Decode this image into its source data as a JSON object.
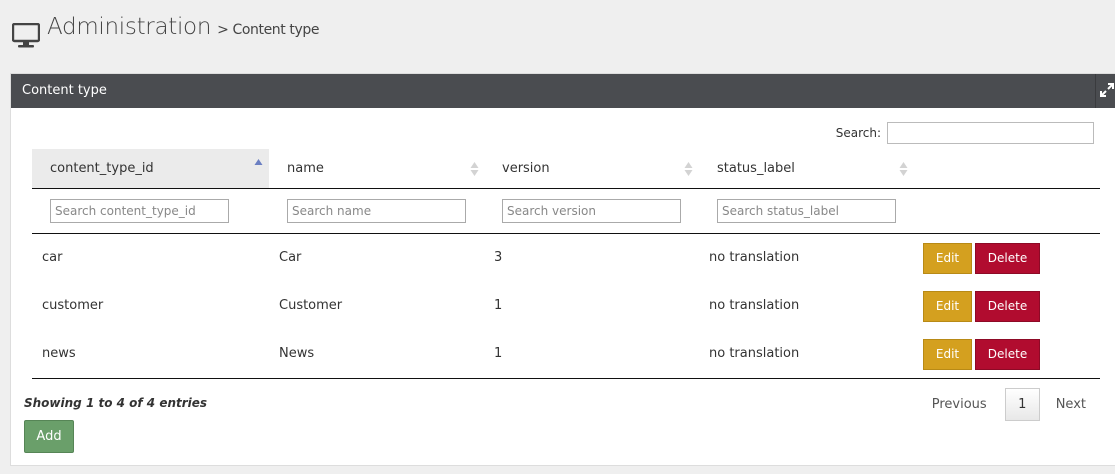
{
  "header": {
    "title": "Administration",
    "breadcrumb": "> Content type",
    "icon": "monitor-icon"
  },
  "panel": {
    "title": "Content type",
    "expand_icon": "expand-icon"
  },
  "search": {
    "label": "Search:",
    "value": ""
  },
  "table": {
    "columns": [
      {
        "label": "content_type_id",
        "filter_placeholder": "Search content_type_id"
      },
      {
        "label": "name",
        "filter_placeholder": "Search name"
      },
      {
        "label": "version",
        "filter_placeholder": "Search version"
      },
      {
        "label": "status_label",
        "filter_placeholder": "Search status_label"
      }
    ],
    "rows": [
      {
        "content_type_id": "car",
        "name": "Car",
        "version": "3",
        "status_label": "no translation"
      },
      {
        "content_type_id": "customer",
        "name": "Customer",
        "version": "1",
        "status_label": "no translation"
      },
      {
        "content_type_id": "news",
        "name": "News",
        "version": "1",
        "status_label": "no translation"
      }
    ],
    "edit_label": "Edit",
    "delete_label": "Delete"
  },
  "footer": {
    "info": "Showing 1 to 4 of 4 entries",
    "previous": "Previous",
    "page": "1",
    "next": "Next",
    "add_label": "Add"
  },
  "colors": {
    "panel_heading": "#4a4c50",
    "edit": "#d4a01f",
    "delete": "#b10c2f",
    "add": "#6a9f6a"
  }
}
